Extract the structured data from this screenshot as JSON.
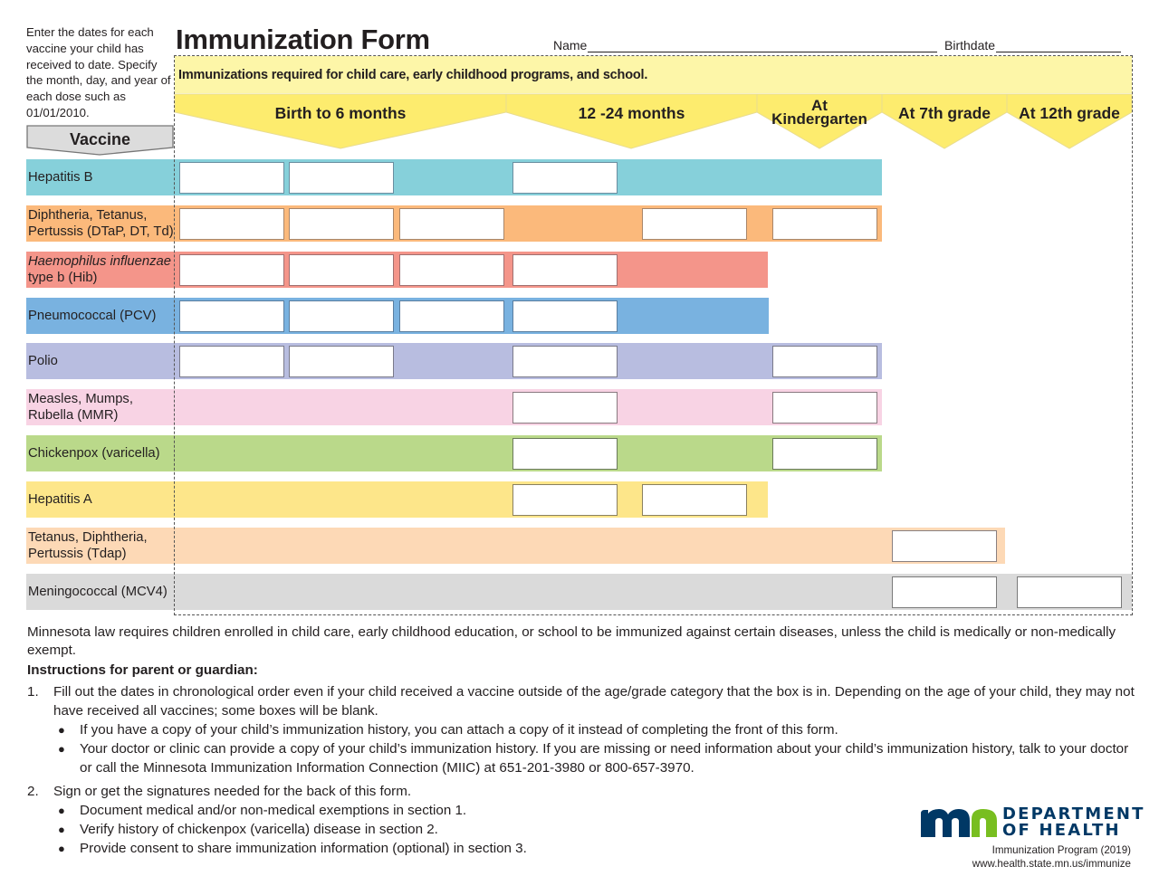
{
  "intro_text": "Enter the dates for each vaccine your child has received to date. Specify the month, day, and year of each dose such as 01/01/2010.",
  "title": "Immunization Form",
  "name_label": "Name",
  "name_value": "",
  "birthdate_label": "Birthdate",
  "birthdate_value": "",
  "required_banner": "Immunizations required for child care, early childhood programs, and school.",
  "vaccine_header": "Vaccine",
  "columns": [
    {
      "label": "Birth to 6 months"
    },
    {
      "label": "12 -24 months"
    },
    {
      "label_line1": "At",
      "label_line2": "Kindergarten"
    },
    {
      "label": "At 7th grade"
    },
    {
      "label": "At 12th grade"
    }
  ],
  "vaccines": [
    {
      "name": "Hepatitis B",
      "color": "#86d0da",
      "border": "#6a8ea0",
      "boxes": 3
    },
    {
      "name": "Diphtheria, Tetanus, Pertussis (DTaP, DT, Td)",
      "color": "#fbb97b",
      "border": "#a8866a",
      "boxes": 5
    },
    {
      "name_italic": "Haemophilus influenzae",
      "name_rest": " type b (Hib)",
      "color": "#f4958a",
      "border": "#a07070",
      "boxes": 4
    },
    {
      "name": "Pneumococcal (PCV)",
      "color": "#79b2e0",
      "border": "#5a7ea0",
      "boxes": 4
    },
    {
      "name": "Polio",
      "color": "#b8bde0",
      "border": "#7a7a8a",
      "boxes": 4
    },
    {
      "name": "Measles, Mumps, Rubella (MMR)",
      "color": "#f8d3e4",
      "border": "#8a7a80",
      "boxes": 2
    },
    {
      "name": "Chickenpox (varicella)",
      "color": "#bad98a",
      "border": "#6a7a5a",
      "boxes": 2
    },
    {
      "name": "Hepatitis A",
      "color": "#fde68a",
      "border": "#8a8060",
      "boxes": 2
    },
    {
      "name": "Tetanus, Diphtheria, Pertussis (Tdap)",
      "color": "#fdd9b6",
      "border": "#8a8080",
      "boxes": 1
    },
    {
      "name": "Meningococcal (MCV4)",
      "color": "#dadada",
      "border": "#7a7a7a",
      "boxes": 2
    }
  ],
  "law_text": "Minnesota law requires children enrolled in child care, early childhood education, or school to be immunized against certain diseases, unless the child is medically or non-medically exempt.",
  "instructions_title": "Instructions for parent or guardian:",
  "instructions": [
    {
      "num": "1.",
      "text": "Fill out the dates in chronological order even if your child received a vaccine outside of the age/grade category that the box is in. Depending on the age of your child, they may not have received all vaccines; some boxes will be blank.",
      "bullets": [
        "If you have a copy of your child’s immunization history, you can attach a copy of it instead of completing the front of this form.",
        "Your doctor or clinic can provide a copy of your child’s immunization history. If you are missing or need information about your child’s immunization history, talk to your doctor or call the Minnesota Immunization Information Connection (MIIC) at 651-201-3980 or 800-657-3970."
      ]
    },
    {
      "num": "2.",
      "text": "Sign or get the signatures needed for the back of this form.",
      "bullets": [
        "Document medical and/or non-medical exemptions in section 1.",
        "Verify history of chickenpox (varicella) disease in section 2.",
        "Provide consent to share immunization information (optional) in section 3."
      ]
    }
  ],
  "logo": {
    "dept_line1": "DEPARTMENT",
    "dept_line2": "OF HEALTH",
    "mn_blue": "#003865",
    "mn_green": "#78be20"
  },
  "program": "Immunization Program (2019)",
  "website": "www.health.state.mn.us/immunize",
  "bullet_glyph": "●"
}
